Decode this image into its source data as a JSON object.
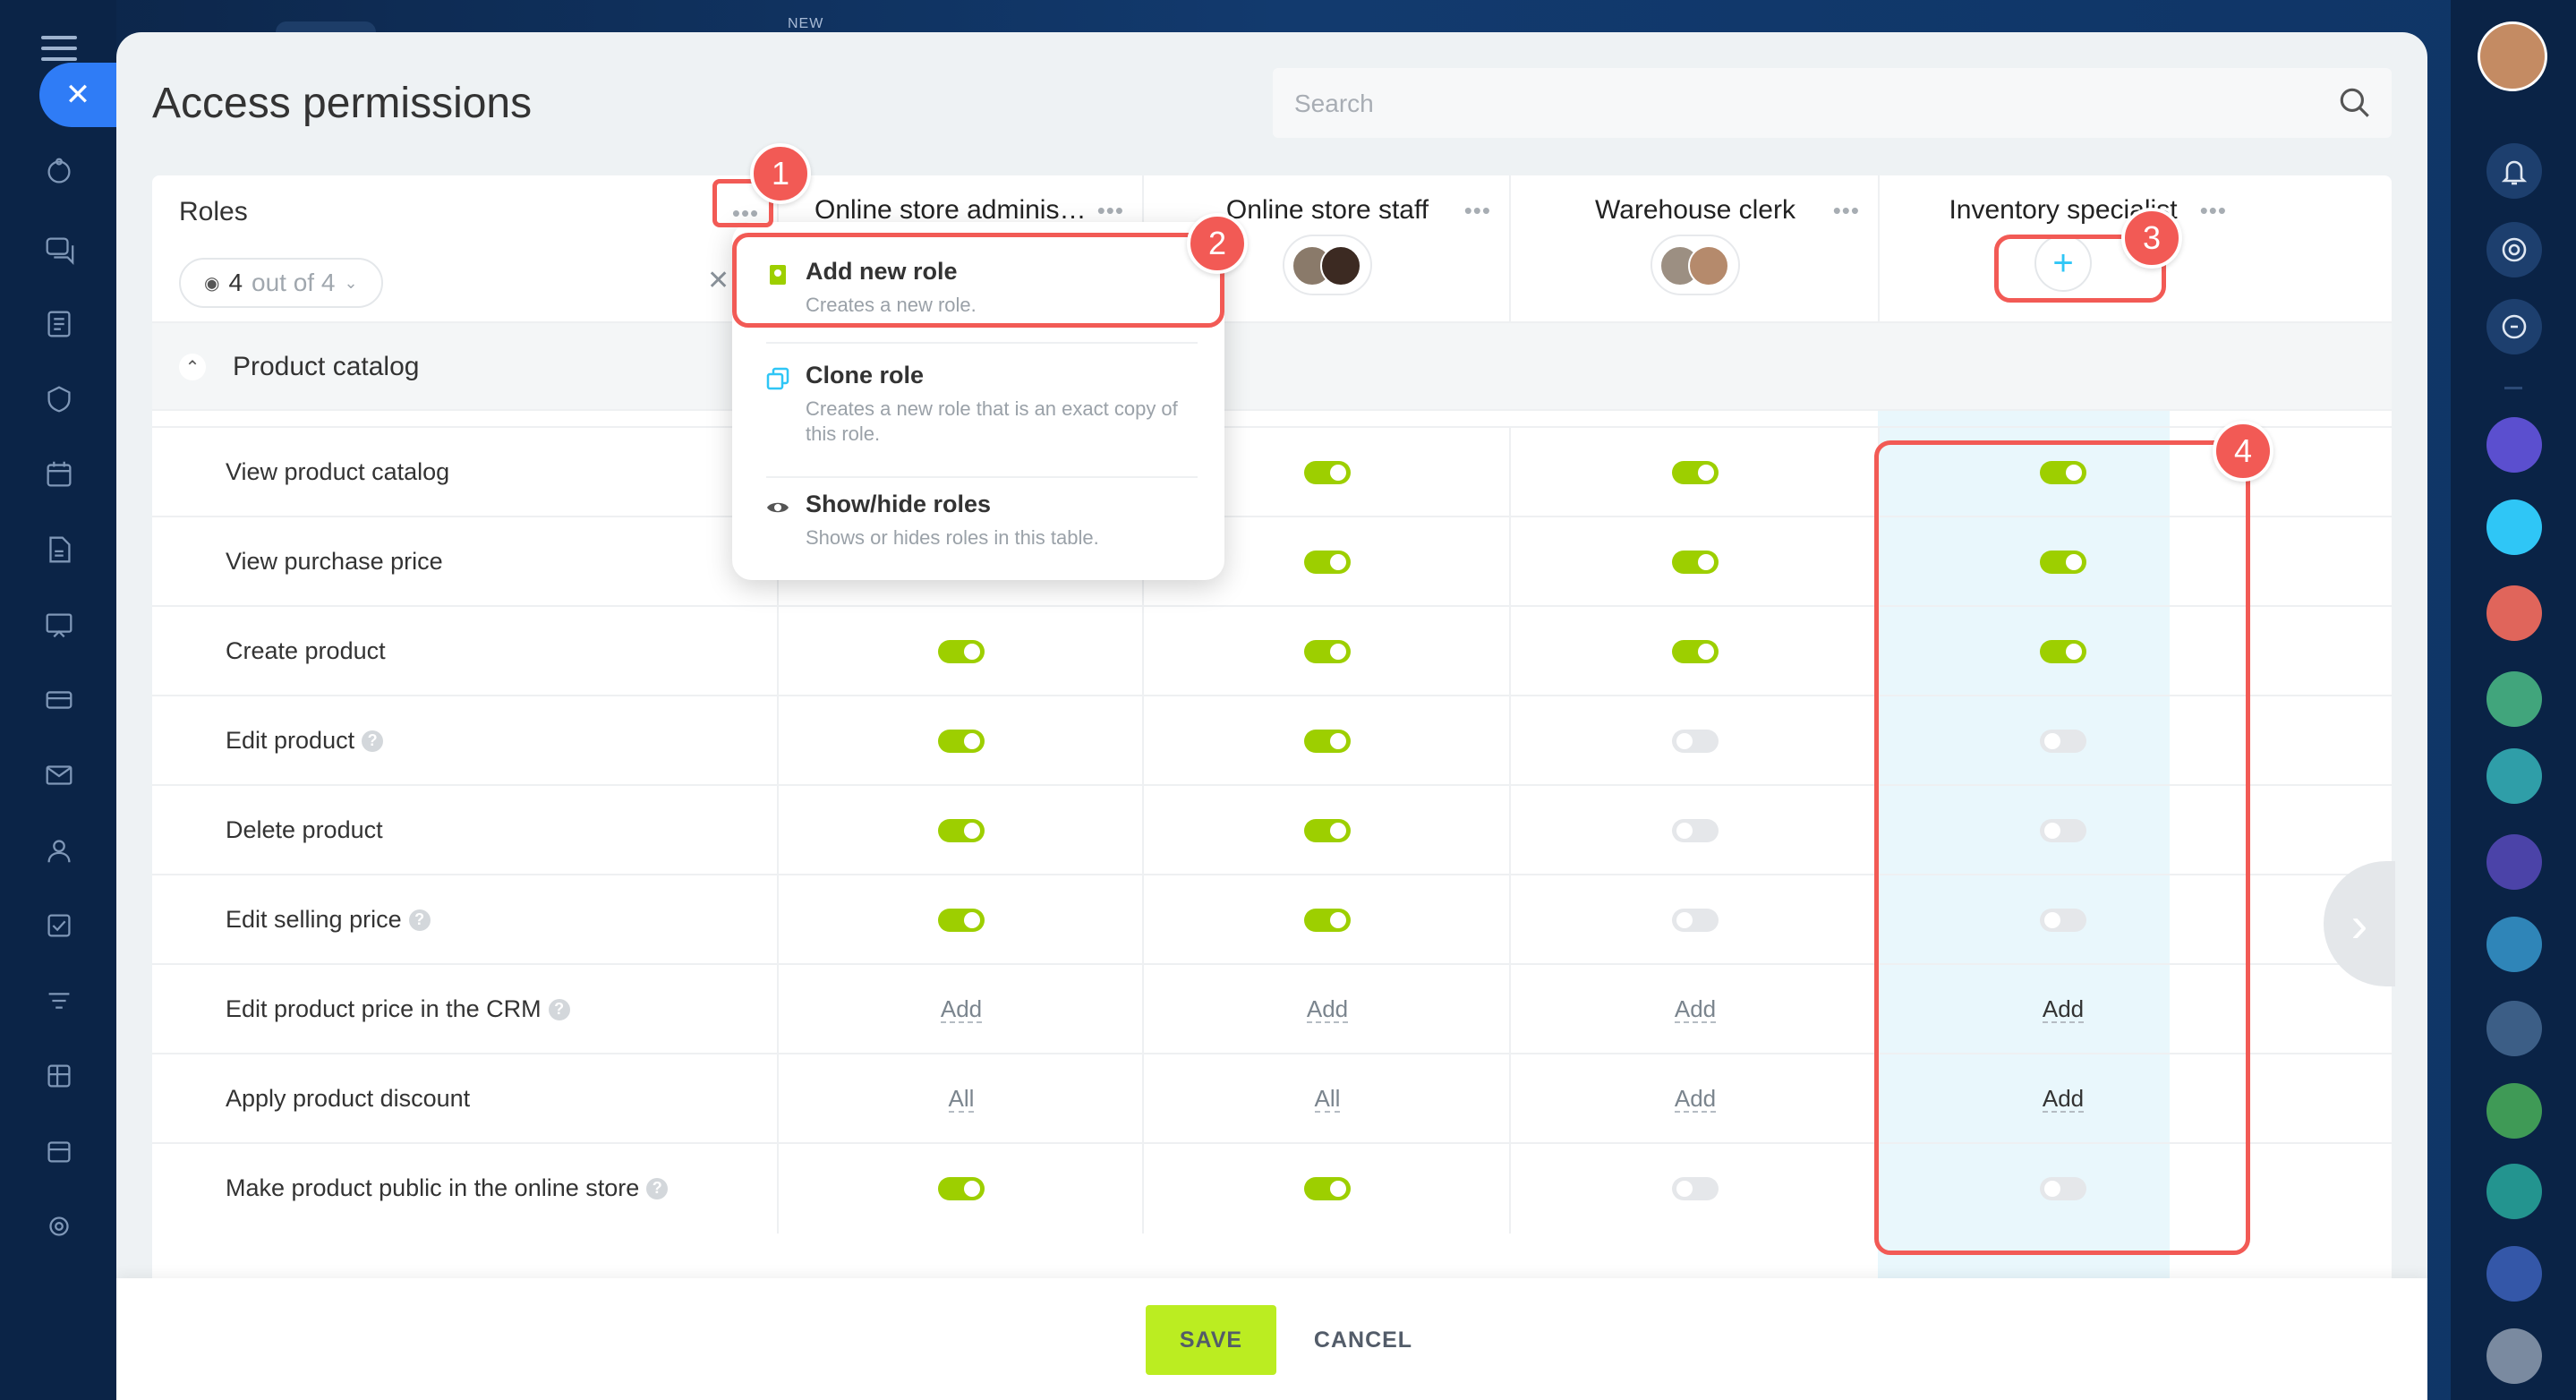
{
  "app": {
    "new_tag": "NEW"
  },
  "page": {
    "title": "Access permissions"
  },
  "search": {
    "placeholder": "Search"
  },
  "roles": {
    "heading": "Roles",
    "counter_value": "4",
    "counter_suffix": "out of 4"
  },
  "columns": [
    {
      "name": "Online store administr..."
    },
    {
      "name": "Online store staff"
    },
    {
      "name": "Warehouse clerk"
    },
    {
      "name": "Inventory specialist"
    }
  ],
  "section": {
    "label": "Product catalog"
  },
  "menu": {
    "items": [
      {
        "title": "Add new role",
        "desc": "Creates a new role."
      },
      {
        "title": "Clone role",
        "desc": "Creates a new role that is an exact copy of this role."
      },
      {
        "title": "Show/hide roles",
        "desc": "Shows or hides roles in this table."
      }
    ]
  },
  "rows": [
    {
      "label": "View product catalog",
      "help": false,
      "values": [
        "on",
        "on",
        "on",
        "on"
      ]
    },
    {
      "label": "View purchase price",
      "help": false,
      "values": [
        "on",
        "on",
        "on",
        "on"
      ]
    },
    {
      "label": "Create product",
      "help": false,
      "values": [
        "on",
        "on",
        "on",
        "on"
      ]
    },
    {
      "label": "Edit product",
      "help": true,
      "values": [
        "on",
        "on",
        "off",
        "off"
      ]
    },
    {
      "label": "Delete product",
      "help": false,
      "values": [
        "on",
        "on",
        "off",
        "off"
      ]
    },
    {
      "label": "Edit selling price",
      "help": true,
      "values": [
        "on",
        "on",
        "off",
        "off"
      ]
    },
    {
      "label": "Edit product price in the CRM",
      "help": true,
      "values": [
        "Add",
        "Add",
        "Add",
        "Add"
      ]
    },
    {
      "label": "Apply product discount",
      "help": false,
      "values": [
        "All",
        "All",
        "Add",
        "Add"
      ]
    },
    {
      "label": "Make product public in the online store",
      "help": true,
      "values": [
        "on",
        "on",
        "off",
        "off"
      ]
    }
  ],
  "badges": [
    "1",
    "2",
    "3",
    "4"
  ],
  "footer": {
    "save": "SAVE",
    "cancel": "CANCEL"
  },
  "colors": {
    "accent": "#bbed21",
    "toggle_on": "#9dcf00",
    "annotation": "#f25a55",
    "highlight": "#e9f7fc"
  }
}
